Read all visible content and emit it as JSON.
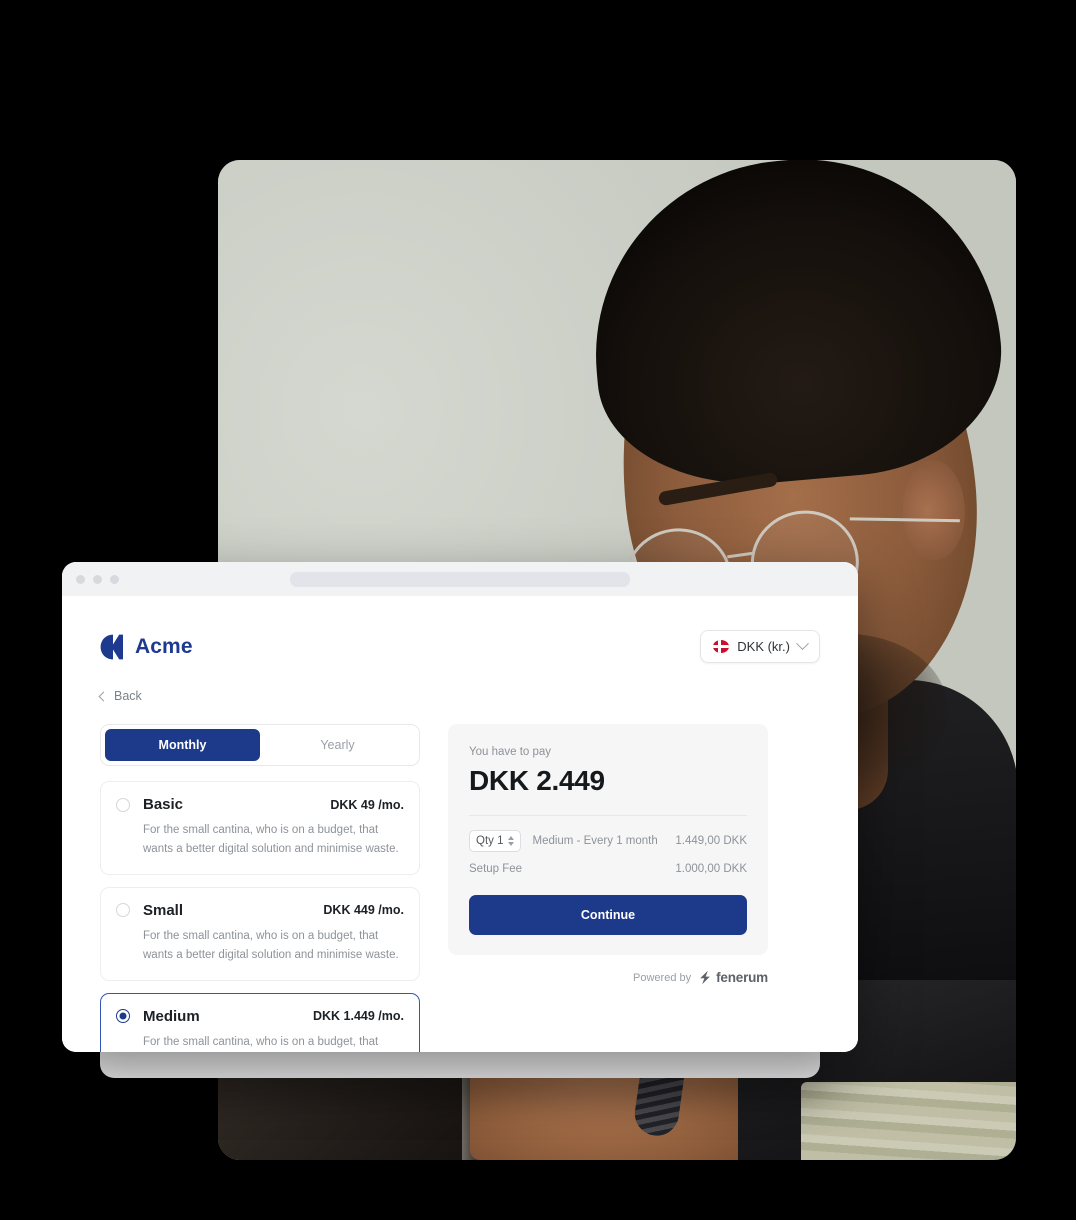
{
  "window": {
    "controls": [
      "close",
      "minimize",
      "maximize"
    ],
    "address_bar_value": ""
  },
  "header": {
    "brand_name": "Acme",
    "brand_mark_icon": "acme-logo-icon",
    "currency": {
      "flag_icon": "flag-denmark-icon",
      "label": "DKK (kr.)",
      "chevron_icon": "chevron-down-icon"
    }
  },
  "nav": {
    "back_icon": "chevron-left-icon",
    "back_label": "Back"
  },
  "billing": {
    "options": [
      {
        "label": "Monthly",
        "active": true
      },
      {
        "label": "Yearly",
        "active": false
      }
    ]
  },
  "plans": [
    {
      "name": "Basic",
      "price": "DKK 49 /mo.",
      "description": "For the small cantina, who is on a budget, that wants a better digital solution and minimise waste.",
      "selected": false
    },
    {
      "name": "Small",
      "price": "DKK 449 /mo.",
      "description": "For the small cantina, who is on a budget, that wants a better digital solution and minimise waste.",
      "selected": false
    },
    {
      "name": "Medium",
      "price": "DKK 1.449 /mo.",
      "description": "For the small cantina, who is on a budget, that wants a better digital solution and minimise waste.",
      "selected": true
    }
  ],
  "summary": {
    "label": "You have to pay",
    "total": "DKK 2.449",
    "items": [
      {
        "qty_label": "Qty 1",
        "name": "Medium - Every 1 month",
        "amount": "1.449,00 DKK"
      },
      {
        "name": "Setup Fee",
        "amount": "1.000,00 DKK"
      }
    ],
    "continue_label": "Continue"
  },
  "footer": {
    "powered_by": "Powered by",
    "provider_name": "fenerum",
    "provider_icon": "fenerum-bolt-icon"
  },
  "colors": {
    "brand_blue": "#1d3a8a",
    "selected_border": "#3355b5",
    "panel_bg": "#f6f6f7",
    "flag_red": "#c8102e",
    "canvas": "#000000"
  }
}
